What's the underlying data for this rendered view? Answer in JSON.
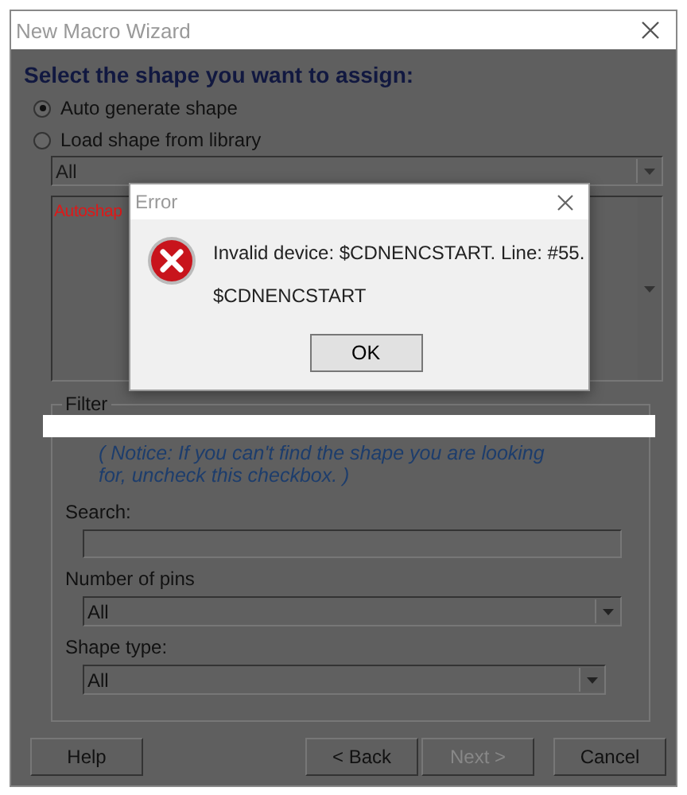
{
  "window": {
    "title": "New Macro Wizard"
  },
  "heading": "Select the shape you want to assign:",
  "shape_source": [
    {
      "label": "Auto generate shape",
      "selected": true
    },
    {
      "label": "Load shape from library",
      "selected": false
    }
  ],
  "library_dropdown": {
    "value": "All"
  },
  "shape_list": {
    "items": [
      "Autoshap"
    ]
  },
  "filter": {
    "legend": "Filter",
    "notice": "( Notice: If you can't find the shape you are looking for, uncheck this checkbox. )",
    "search": {
      "label": "Search:"
    },
    "pins": {
      "label": "Number of pins",
      "value": "All"
    },
    "shape_type": {
      "label": "Shape type:",
      "value": "All"
    }
  },
  "buttons": [
    {
      "label": "Help",
      "disabled": false,
      "kind": "left"
    },
    {
      "label": "< Back",
      "disabled": false,
      "kind": "right"
    },
    {
      "label": "Next >",
      "disabled": true,
      "kind": "right"
    },
    {
      "label": "Cancel",
      "disabled": false,
      "kind": "right"
    }
  ],
  "error_dialog": {
    "title": "Error",
    "message": "Invalid device: $CDNENCSTART. Line: #55.",
    "detail": "$CDNENCSTART",
    "button": "OK"
  }
}
